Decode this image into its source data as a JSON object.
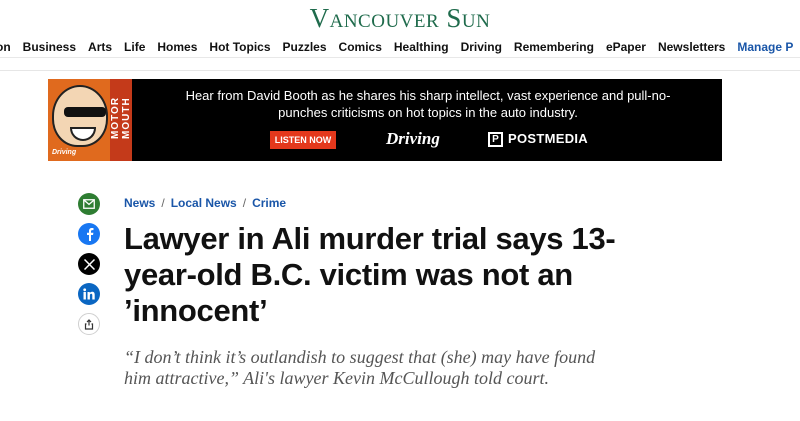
{
  "site": {
    "logo_text": "Vancouver Sun"
  },
  "nav": {
    "items": [
      "on",
      "Business",
      "Arts",
      "Life",
      "Homes",
      "Hot Topics",
      "Puzzles",
      "Comics",
      "Healthing",
      "Driving",
      "Remembering",
      "ePaper",
      "Newsletters",
      "Manage P"
    ]
  },
  "ad": {
    "headline": "Hear from David Booth as he shares his sharp intellect, vast experience and pull-no-punches criticisms on hot topics in the auto industry.",
    "cta": "LISTEN NOW",
    "brand_driving": "Driving",
    "brand_postmedia": "POSTMEDIA",
    "art_title": "MOTOR MOUTH",
    "art_brand": "Driving",
    "pm_mark": "P"
  },
  "share": {
    "icons": [
      "email-icon",
      "facebook-icon",
      "x-icon",
      "linkedin-icon",
      "share-icon"
    ],
    "colors": {
      "email": "#2e7d32",
      "facebook": "#1877f2",
      "x": "#000000",
      "linkedin": "#0a66c2"
    }
  },
  "breadcrumb": {
    "items": [
      "News",
      "Local News",
      "Crime"
    ],
    "separator": "/"
  },
  "article": {
    "headline": "Lawyer in Ali murder trial says 13-year-old B.C. victim was not an ’innocent’",
    "dek": "“I don’t think it’s outlandish to suggest that (she) may have found him attractive,” Ali's lawyer Kevin McCullough told court."
  },
  "colors": {
    "brand": "#1f6b4c",
    "link": "#1a56a8",
    "ad_cta": "#e4381c"
  }
}
